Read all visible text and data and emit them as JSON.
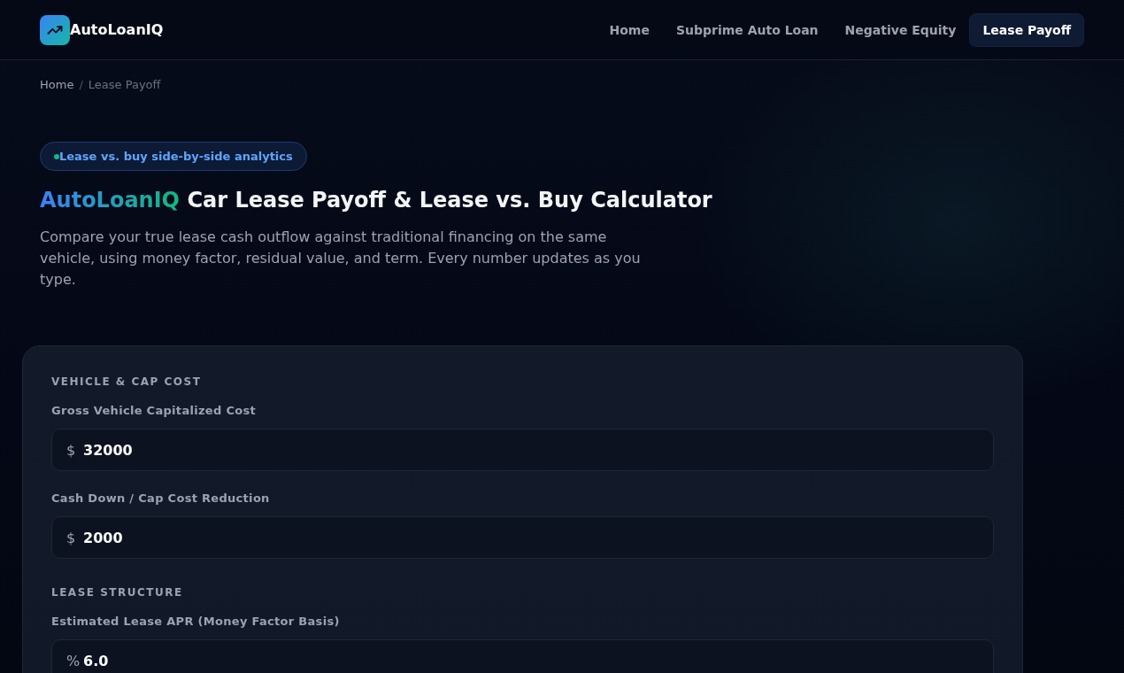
{
  "header": {
    "logo": {
      "text": "AutoLoanIQ"
    },
    "nav": [
      {
        "label": "Home",
        "selected": false
      },
      {
        "label": "Subprime Auto Loan",
        "selected": false
      },
      {
        "label": "Negative Equity",
        "selected": false
      },
      {
        "label": "Lease Payoff",
        "selected": true
      }
    ]
  },
  "breadcrumb": {
    "separator": "/",
    "items": [
      {
        "label": "Home",
        "current": false
      },
      {
        "label": "Lease Payoff",
        "current": true
      }
    ]
  },
  "badge": {
    "text": "Lease vs. buy side-by-side analytics"
  },
  "title": {
    "brand": "AutoLoanIQ",
    "text": "Car Lease Payoff & Lease vs. Buy Calculator"
  },
  "description": "Compare your true lease cash outflow against traditional financing on the same vehicle, using money factor, residual value, and term. Every number updates as you type.",
  "form": {
    "sections": [
      {
        "heading": "VEHICLE & CAP COST",
        "fields": [
          {
            "label": "Gross Vehicle Capitalized Cost",
            "prefix": "$",
            "value": "32000"
          },
          {
            "label": "Cash Down / Cap Cost Reduction",
            "prefix": "$",
            "value": "2000"
          }
        ]
      },
      {
        "heading": "LEASE STRUCTURE",
        "fields": [
          {
            "label": "Estimated Lease APR (Money Factor Basis)",
            "prefix": "%",
            "value": "6.0"
          }
        ]
      }
    ]
  }
}
